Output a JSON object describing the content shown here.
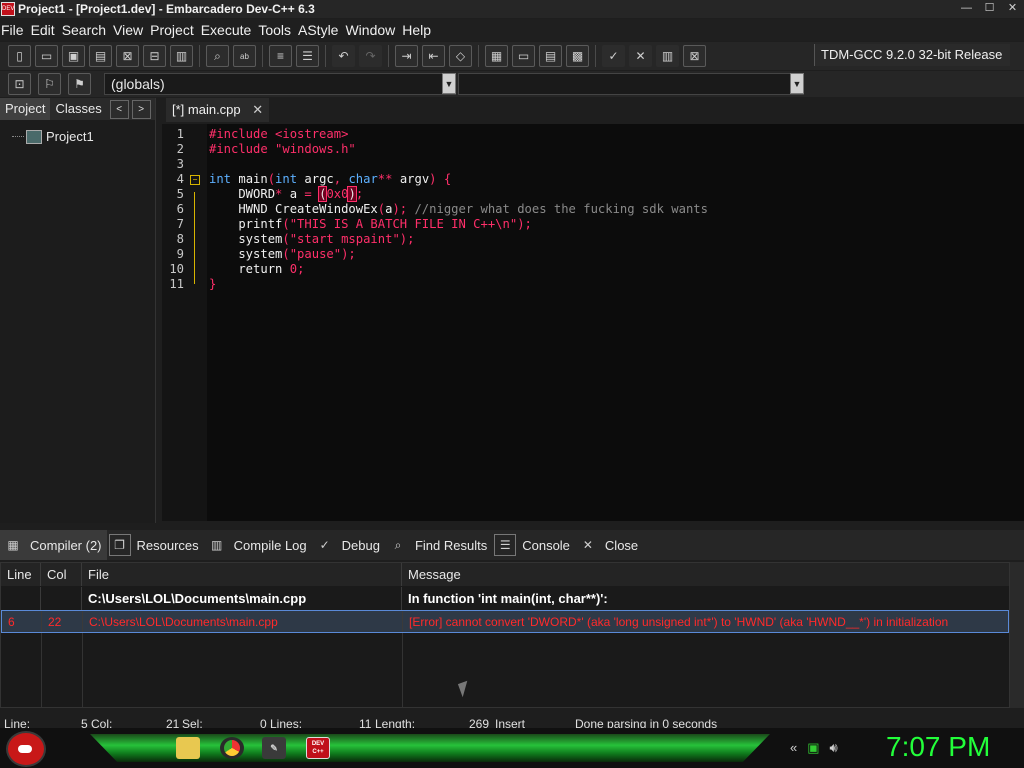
{
  "window": {
    "title": "Project1 - [Project1.dev] - Embarcadero Dev-C++ 6.3",
    "app_icon": "DEV C++",
    "controls": [
      "—",
      "☐",
      "✕"
    ]
  },
  "menu": [
    "File",
    "Edit",
    "Search",
    "View",
    "Project",
    "Execute",
    "Tools",
    "AStyle",
    "Window",
    "Help"
  ],
  "toolbar": {
    "compiler": "TDM-GCC 9.2.0 32-bit Release",
    "icons": [
      "new-file-icon",
      "open-icon",
      "save-icon",
      "save-all-icon",
      "close-icon",
      "close-all-icon",
      "print-icon",
      "find-icon",
      "replace-icon",
      "indent-icon",
      "unindent-icon",
      "undo-icon",
      "redo-icon",
      "goto-icon",
      "bookmark-icon",
      "comment-icon",
      "compile-icon",
      "run-icon",
      "compile-run-icon",
      "rebuild-icon",
      "check-icon",
      "stop-icon",
      "profile-icon",
      "debug-stop-icon"
    ]
  },
  "scope": {
    "globals": "(globals)"
  },
  "left_panel": {
    "tabs": [
      "Project",
      "Classes"
    ],
    "nav": [
      "<",
      ">"
    ],
    "project_name": "Project1"
  },
  "editor": {
    "tab_label": "[*] main.cpp",
    "tab_close": "✕"
  },
  "code_lines": [
    {
      "n": "1",
      "text": "#include <iostream>"
    },
    {
      "n": "2",
      "text": "#include \"windows.h\""
    },
    {
      "n": "3",
      "text": ""
    },
    {
      "n": "4",
      "text": "int main(int argc, char** argv) {"
    },
    {
      "n": "5",
      "text": "    DWORD* a = (0x0);"
    },
    {
      "n": "6",
      "text": "    HWND CreateWindowEx(a); //nigger what does the fucking sdk wants"
    },
    {
      "n": "7",
      "text": "    printf(\"THIS IS A BATCH FILE IN C++\\n\");"
    },
    {
      "n": "8",
      "text": "    system(\"start mspaint\");"
    },
    {
      "n": "9",
      "text": "    system(\"pause\");"
    },
    {
      "n": "10",
      "text": "    return 0;"
    },
    {
      "n": "11",
      "text": "}"
    }
  ],
  "bottom_tabs": [
    "Compiler (2)",
    "Resources",
    "Compile Log",
    "Debug",
    "Find Results",
    "Console",
    "Close"
  ],
  "messages": {
    "headers": [
      "Line",
      "Col",
      "File",
      "Message"
    ],
    "rows": [
      {
        "line": "",
        "col": "",
        "file": "C:\\Users\\LOL\\Documents\\main.cpp",
        "message": "In function 'int main(int, char**)':"
      },
      {
        "line": "6",
        "col": "22",
        "file": "C:\\Users\\LOL\\Documents\\main.cpp",
        "message": "[Error] cannot convert 'DWORD*' (aka 'long unsigned int*') to 'HWND' (aka 'HWND__*') in initialization"
      }
    ]
  },
  "status": {
    "line_label": "Line:",
    "line": "5",
    "col_label": "Col:",
    "col": "21",
    "sel_label": "Sel:",
    "sel": "0",
    "lines_label": "Lines:",
    "lines": "11",
    "length_label": "Length:",
    "length": "269",
    "mode": "Insert",
    "parse": "Done parsing in 0 seconds"
  },
  "taskbar": {
    "clock": "7:07 PM",
    "devcpp_icon": "DEV C++"
  },
  "colors": {
    "keyword": "#5db0ff",
    "string": "#ff2f6a",
    "comment": "#8a8a8a",
    "error": "#ff2a2a",
    "clock": "#22ff3a"
  }
}
